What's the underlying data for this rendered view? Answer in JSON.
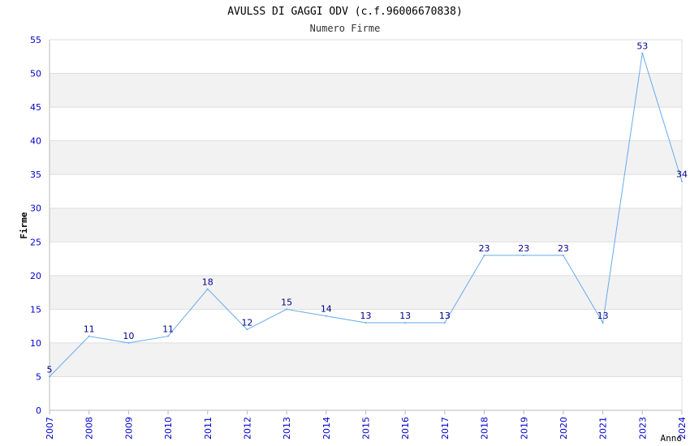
{
  "chart_data": {
    "type": "line",
    "title": "AVULSS DI GAGGI ODV (c.f.96006670838)",
    "subtitle": "Numero Firme",
    "xlabel": "Anno",
    "ylabel": "Firme",
    "categories": [
      "2007",
      "2008",
      "2009",
      "2010",
      "2011",
      "2012",
      "2013",
      "2014",
      "2015",
      "2016",
      "2017",
      "2018",
      "2019",
      "2020",
      "2021",
      "2023",
      "2024"
    ],
    "values": [
      5,
      11,
      10,
      11,
      18,
      12,
      15,
      14,
      13,
      13,
      13,
      23,
      23,
      23,
      13,
      53,
      34
    ],
    "ylim": [
      0,
      55
    ],
    "yticks": [
      0,
      5,
      10,
      15,
      20,
      25,
      30,
      35,
      40,
      45,
      50,
      55
    ],
    "grid": "horizontal bands",
    "colors": {
      "line": "#66aaee",
      "band": "#f2f2f2",
      "tick_label": "#0000cc",
      "data_label": "#000088",
      "axis": "#bbbbbb"
    }
  }
}
